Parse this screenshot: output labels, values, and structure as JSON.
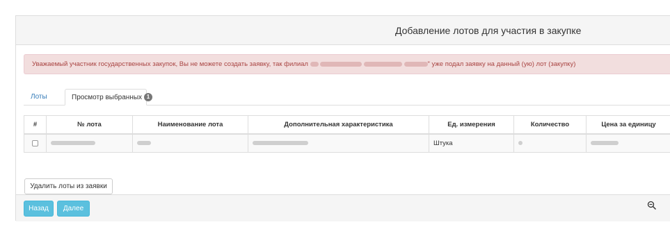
{
  "page": {
    "title": "Добавление лотов для участия в закупке"
  },
  "alert": {
    "text_before": "Уважаемый участник государственных закупок, Вы не можете создать заявку, так филиал",
    "text_after": "\" уже подал заявку на данный (ую) лот (закупку)"
  },
  "tabs": {
    "lots_label": "Лоты",
    "selected_label": "Просмотр выбранных",
    "selected_count": "1"
  },
  "table": {
    "headers": [
      "#",
      "№ лота",
      "Наименование лота",
      "Дополнительная характеристика",
      "Ед. измерения",
      "Количество",
      "Цена за единицу"
    ],
    "rows": [
      {
        "unit": "Штука"
      }
    ]
  },
  "buttons": {
    "remove_label": "Удалить лоты из заявки",
    "back_label": "Назад",
    "next_label": "Далее"
  },
  "icons": {
    "zoom": "zoom-out-icon"
  }
}
